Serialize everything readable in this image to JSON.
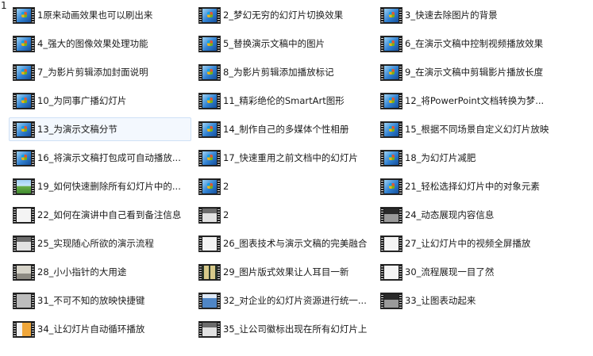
{
  "corner_label": "1",
  "items": [
    {
      "label": "1原来动画效果也可以刷出来",
      "thumb": "win"
    },
    {
      "label": "2_梦幻无穷的幻灯片切换效果",
      "thumb": "win"
    },
    {
      "label": "3_快速去除图片的背景",
      "thumb": "win"
    },
    {
      "label": "4_强大的图像效果处理功能",
      "thumb": "win"
    },
    {
      "label": "5_替换演示文稿中的图片",
      "thumb": "win"
    },
    {
      "label": "6_在演示文稿中控制视频播放效果",
      "thumb": "win"
    },
    {
      "label": "7_为影片剪辑添加封面说明",
      "thumb": "win"
    },
    {
      "label": "8_为影片剪辑添加播放标记",
      "thumb": "win"
    },
    {
      "label": "9_在演示文稿中剪辑影片播放长度",
      "thumb": "win"
    },
    {
      "label": "10_为同事广播幻灯片",
      "thumb": "win"
    },
    {
      "label": "11_精彩绝伦的SmartArt图形",
      "thumb": "win"
    },
    {
      "label": "12_将PowerPoint文档转换为梦...",
      "thumb": "win"
    },
    {
      "label": "13_为演示文稿分节",
      "thumb": "win",
      "selected": true
    },
    {
      "label": "14_制作自己的多媒体个性相册",
      "thumb": "win"
    },
    {
      "label": "15_根据不同场景自定义幻灯片放映",
      "thumb": "win"
    },
    {
      "label": "16_将演示文稿打包成可自动播放...",
      "thumb": "win"
    },
    {
      "label": "17_快速重用之前文档中的幻灯片",
      "thumb": "win"
    },
    {
      "label": "18_为幻灯片减肥",
      "thumb": "win"
    },
    {
      "label": "19_如何快速删除所有幻灯片中的...",
      "thumb": "photo"
    },
    {
      "label": "2",
      "thumb": "win"
    },
    {
      "label": "21_轻松选择幻灯片中的对象元素",
      "thumb": "win"
    },
    {
      "label": "22_如何在演讲中自己看到备注信息",
      "thumb": "white"
    },
    {
      "label": "2",
      "thumb": "sheet"
    },
    {
      "label": "24_动态展现内容信息",
      "thumb": "dark"
    },
    {
      "label": "25_实现随心所欲的演示流程",
      "thumb": "sheet"
    },
    {
      "label": "26_图表技术与演示文稿的完美融合",
      "thumb": "white"
    },
    {
      "label": "27_让幻灯片中的视频全屏播放",
      "thumb": "white"
    },
    {
      "label": "28_小小指针的大用途",
      "thumb": "desk"
    },
    {
      "label": "29_图片版式效果让人耳目一新",
      "thumb": "tiles"
    },
    {
      "label": "30_流程展现一目了然",
      "thumb": "white"
    },
    {
      "label": "31_不可不知的放映快捷键",
      "thumb": "gray"
    },
    {
      "label": "32_对企业的幻灯片资源进行统一...",
      "thumb": "blue2"
    },
    {
      "label": "33_让图表动起来",
      "thumb": "dark"
    },
    {
      "label": "34_让幻灯片自动循环播放",
      "thumb": "orange"
    },
    {
      "label": "35_让公司徽标出现在所有幻灯片上",
      "thumb": "sheet"
    }
  ]
}
